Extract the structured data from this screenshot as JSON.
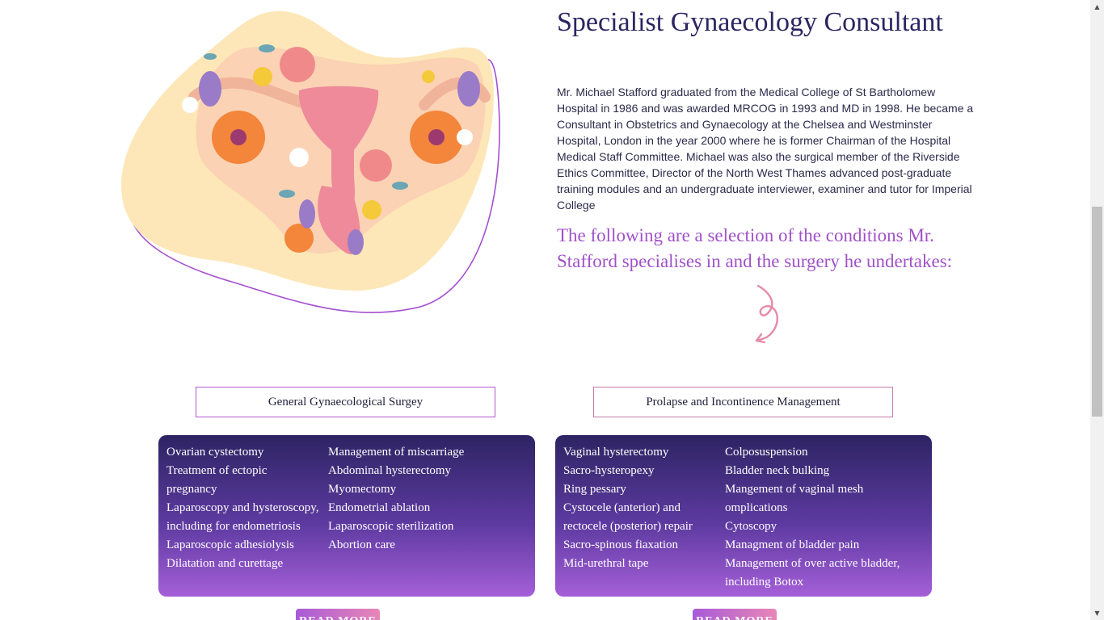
{
  "page": {
    "title": "Specialist Gynaecology Consultant",
    "bio": "Mr. Michael Stafford graduated from the Medical College of St Bartholomew Hospital in 1986 and was awarded MRCOG in 1993 and MD in 1998. He became a Consultant in Obstetrics and Gynaecology at the Chelsea and Westminster Hospital, London in the year 2000 where he is former Chairman of the Hospital Medical Staff Committee. Michael was also the surgical member of the Riverside Ethics Committee, Director of the North West Thames advanced post-graduate training modules and an undergraduate interviewer, examiner and tutor for Imperial College",
    "conditions_intro": "The following are a selection of the conditions Mr. Stafford specialises in and the surgery he undertakes:"
  },
  "colors": {
    "heading": "#2b2562",
    "accent": "#a052c8",
    "panel_top": "#2d2463",
    "panel_bottom": "#a55fd8",
    "blob": "#fde7b8",
    "arrow": "#e58aa8"
  },
  "illustration": {
    "icon": "uterus-floral-illustration"
  },
  "categories": [
    {
      "label": "General Gynaecological Surgey",
      "col1": [
        "Ovarian cystectomy",
        "Treatment of ectopic pregnancy",
        "Laparoscopy and hysteroscopy, including for endometriosis",
        "Laparoscopic adhesiolysis",
        "Dilatation and curettage"
      ],
      "col2": [
        "Management of miscarriage",
        "Abdominal hysterectomy",
        "Myomectomy",
        "Endometrial ablation",
        "Laparoscopic sterilization",
        "Abortion care"
      ],
      "button": "READ MORE"
    },
    {
      "label": "Prolapse and Incontinence Management",
      "col1": [
        "Vaginal hysterectomy",
        "Sacro-hysteropexy",
        "Ring pessary",
        "Cystocele (anterior) and rectocele (posterior) repair",
        "Sacro-spinous fiaxation",
        "Mid-urethral tape"
      ],
      "col2": [
        "Colposuspension",
        "Bladder neck bulking",
        "Mangement of vaginal mesh omplications",
        "Cytoscopy",
        "Managment of bladder pain",
        "Management of over active bladder, including Botox"
      ],
      "button": "READ MORE"
    }
  ]
}
